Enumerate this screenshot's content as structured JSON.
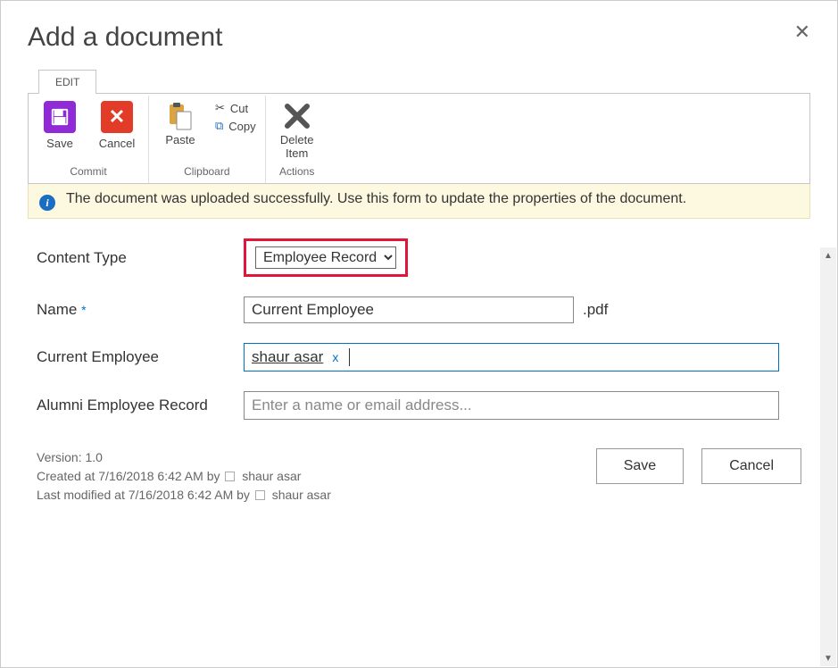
{
  "dialog": {
    "title": "Add a document"
  },
  "ribbon": {
    "tab": "EDIT",
    "save": "Save",
    "cancel": "Cancel",
    "paste": "Paste",
    "cut": "Cut",
    "copy": "Copy",
    "deleteItem1": "Delete",
    "deleteItem2": "Item",
    "groupCommit": "Commit",
    "groupClipboard": "Clipboard",
    "groupActions": "Actions"
  },
  "notification": "The document was uploaded successfully. Use this form to update the properties of the document.",
  "form": {
    "contentTypeLabel": "Content Type",
    "contentTypeValue": "Employee Record",
    "nameLabel": "Name",
    "nameRequired": "*",
    "nameValue": "Current Employee",
    "nameExt": ".pdf",
    "currentEmployeeLabel": "Current Employee",
    "currentEmployeeTag": "shaur asar",
    "alumniLabel": "Alumni Employee Record",
    "alumniPlaceholder": "Enter a name or email address..."
  },
  "meta": {
    "version": "Version: 1.0",
    "createdPrefix": "Created at 7/16/2018 6:42 AM  by",
    "createdUser": "shaur asar",
    "modifiedPrefix": "Last modified at 7/16/2018 6:42 AM  by",
    "modifiedUser": "shaur asar"
  },
  "buttons": {
    "save": "Save",
    "cancel": "Cancel"
  }
}
